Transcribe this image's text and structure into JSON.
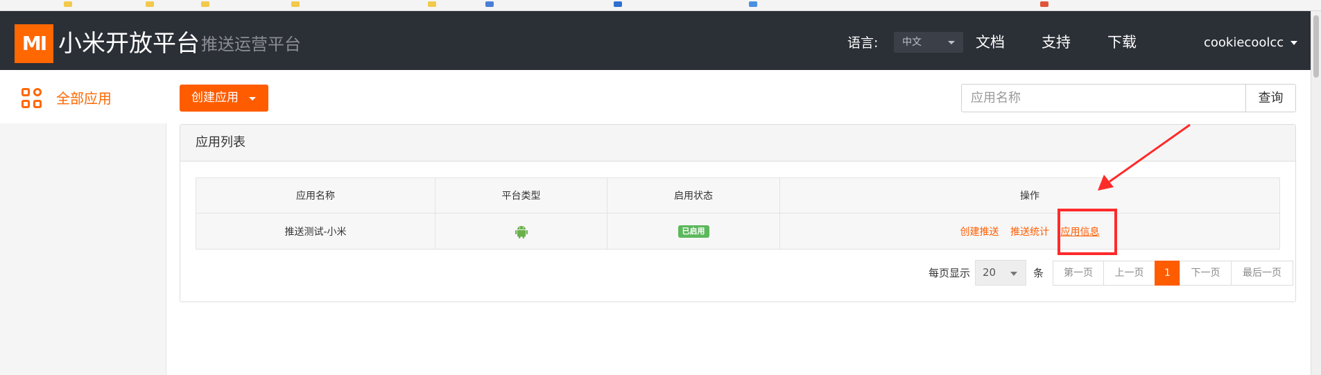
{
  "header": {
    "logo_text": "MI",
    "brand": "小米开放平台",
    "separator": "·",
    "sub_brand": "推送运营平台",
    "language_label": "语言:",
    "language_value": "中文",
    "nav": [
      "文档",
      "支持",
      "下载"
    ],
    "username": "cookiecoolcc"
  },
  "sidebar": {
    "items": [
      {
        "label": "全部应用",
        "icon": "grid-apps-icon"
      }
    ]
  },
  "toolbar": {
    "create_label": "创建应用",
    "search_placeholder": "应用名称",
    "search_button": "查询"
  },
  "panel": {
    "title": "应用列表",
    "columns": [
      "应用名称",
      "平台类型",
      "启用状态",
      "操作"
    ],
    "rows": [
      {
        "name": "推送测试-小米",
        "platform_icon": "android-icon",
        "status": "已启用",
        "actions": [
          "创建推送",
          "推送统计",
          "应用信息"
        ]
      }
    ]
  },
  "pagination": {
    "per_page_label": "每页显示",
    "per_page_value": "20",
    "unit": "条",
    "first": "第一页",
    "prev": "上一页",
    "current": "1",
    "next": "下一页",
    "last": "最后一页"
  },
  "colors": {
    "accent": "#ff6700",
    "header_bg": "#2b2f36",
    "status_green": "#5cb85c",
    "annotation_red": "#ff2a2a"
  }
}
